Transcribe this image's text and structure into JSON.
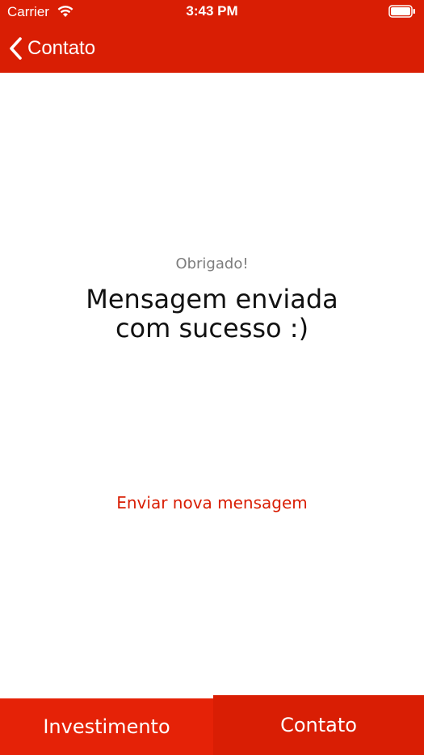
{
  "status_bar": {
    "carrier": "Carrier",
    "time": "3:43 PM",
    "wifi_icon": "wifi-icon",
    "battery_icon": "battery-full-icon"
  },
  "nav_bar": {
    "back_icon": "chevron-left-icon",
    "back_label": "Contato"
  },
  "content": {
    "thanks_label": "Obrigado!",
    "title_line1": "Mensagem enviada",
    "title_line2": "com sucesso :)",
    "new_message_link": "Enviar nova mensagem"
  },
  "tab_bar": {
    "tabs": [
      {
        "label": "Investimento",
        "selected": false
      },
      {
        "label": "Contato",
        "selected": true
      }
    ]
  },
  "colors": {
    "brand_red": "#d91e04",
    "tab_red_light": "#e52207",
    "muted_text": "#7d7d7d"
  }
}
